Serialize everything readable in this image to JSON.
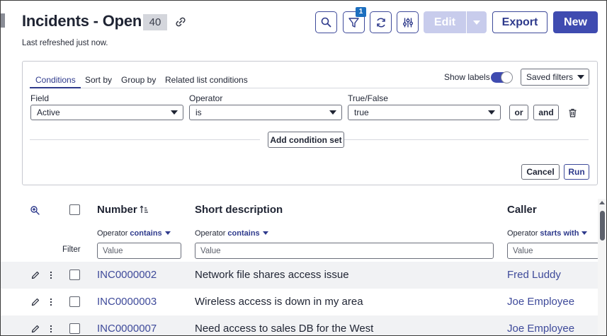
{
  "header": {
    "title": "Incidents - Open",
    "count": "40",
    "refreshed": "Last refreshed just now.",
    "filter_badge": "1",
    "edit_label": "Edit",
    "export_label": "Export",
    "new_label": "New",
    "icons": [
      "search-icon",
      "filter-icon",
      "refresh-icon",
      "settings-sliders-icon",
      "link-icon"
    ]
  },
  "conditions": {
    "tabs": [
      "Conditions",
      "Sort by",
      "Group by",
      "Related list conditions"
    ],
    "active_tab": "Conditions",
    "show_labels": "Show labels",
    "show_labels_on": true,
    "saved_filters": "Saved filters",
    "field_label": "Field",
    "field_value": "Active",
    "operator_label": "Operator",
    "operator_value": "is",
    "value_label": "True/False",
    "value_value": "true",
    "or_label": "or",
    "and_label": "and",
    "add_condition_set": "Add condition set",
    "cancel_label": "Cancel",
    "run_label": "Run"
  },
  "table": {
    "columns": {
      "number": "Number",
      "short_description": "Short description",
      "caller": "Caller"
    },
    "filters": {
      "label": "Filter",
      "operator_word": "Operator",
      "number_op": "contains",
      "desc_op": "contains",
      "caller_op": "starts with",
      "placeholder": "Value"
    },
    "rows": [
      {
        "number": "INC0000002",
        "desc": "Network file shares access issue",
        "caller": "Fred Luddy"
      },
      {
        "number": "INC0000003",
        "desc": "Wireless access is down in my area",
        "caller": "Joe Employee"
      },
      {
        "number": "INC0000007",
        "desc": "Need access to sales DB for the West",
        "caller": "Joe Employee"
      }
    ]
  },
  "colors": {
    "accent": "#3f4bb0",
    "link": "#3e4a9a",
    "badge": "#1d6fbf"
  }
}
